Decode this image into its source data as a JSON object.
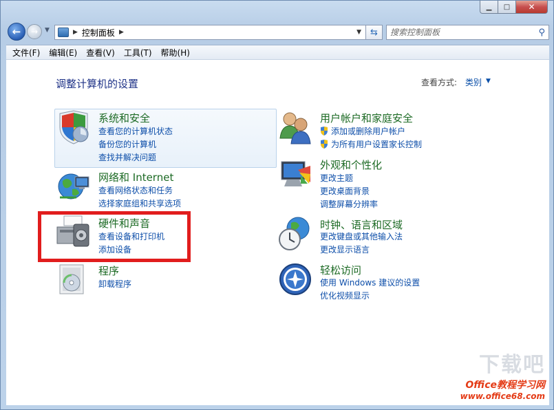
{
  "nav": {
    "back_glyph": "←",
    "forward_glyph": "→",
    "breadcrumb": [
      "控制面板"
    ],
    "search_placeholder": "搜索控制面板"
  },
  "menu": [
    "文件(F)",
    "编辑(E)",
    "查看(V)",
    "工具(T)",
    "帮助(H)"
  ],
  "main": {
    "title": "调整计算机的设置",
    "view_by_label": "查看方式:",
    "view_by_value": "类别"
  },
  "categories": [
    {
      "title": "系统和安全",
      "icon": "shield-icon",
      "links": [
        "查看您的计算机状态",
        "备份您的计算机",
        "查找并解决问题"
      ]
    },
    {
      "title": "网络和 Internet",
      "icon": "globe-network-icon",
      "links": [
        "查看网络状态和任务",
        "选择家庭组和共享选项"
      ]
    },
    {
      "title": "硬件和声音",
      "icon": "printer-icon",
      "links": [
        "查看设备和打印机",
        "添加设备"
      ]
    },
    {
      "title": "程序",
      "icon": "programs-icon",
      "links": [
        "卸载程序"
      ]
    },
    {
      "title": "用户帐户和家庭安全",
      "icon": "users-icon",
      "links": [
        "添加或删除用户帐户",
        "为所有用户设置家长控制"
      ]
    },
    {
      "title": "外观和个性化",
      "icon": "monitor-icon",
      "links": [
        "更改主题",
        "更改桌面背景",
        "调整屏幕分辨率"
      ]
    },
    {
      "title": "时钟、语言和区域",
      "icon": "clock-globe-icon",
      "links": [
        "更改键盘或其他输入法",
        "更改显示语言"
      ]
    },
    {
      "title": "轻松访问",
      "icon": "ease-of-access-icon",
      "links": [
        "使用 Windows 建议的设置",
        "优化视频显示"
      ]
    }
  ],
  "watermark": {
    "line1": "下载吧",
    "line2": "Office教程学习网",
    "line3": "www.office68.com"
  },
  "colors": {
    "title": "#1e3287",
    "category": "#1c6a24",
    "link": "#0d4ea9",
    "highlight": "#e11d1d"
  }
}
